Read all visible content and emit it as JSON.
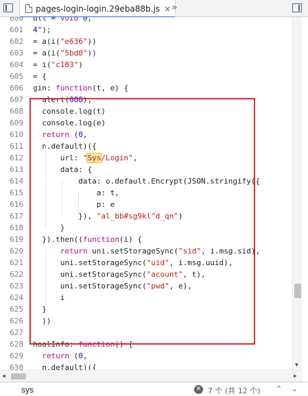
{
  "tabbar": {
    "file_name": "pages-login-login.29eba88b.js",
    "close_glyph": "×",
    "overflow_glyph": "»"
  },
  "search": {
    "query": "sys",
    "match_count": "7 个 (共 12 个)",
    "clear_glyph": "✕",
    "up_glyph": "⌃",
    "down_glyph": "⌄"
  },
  "scroll": {
    "up_glyph": "▲",
    "down_glyph": "▼",
    "left_glyph": "◀",
    "right_glyph": "▶"
  },
  "code": {
    "lines": [
      {
        "n": "600",
        "t": "ult = void 0,"
      },
      {
        "n": "601",
        "t": "4\");"
      },
      {
        "n": "602",
        "t": "= a(i(\"e636\"))"
      },
      {
        "n": "603",
        "t": "= a(i(\"5bd0\"))"
      },
      {
        "n": "604",
        "t": "= i(\"c183\")"
      },
      {
        "n": "605",
        "t": "= {"
      },
      {
        "n": "606",
        "t": "gin: function(t, e) {"
      },
      {
        "n": "607",
        "t": "  alert(888);"
      },
      {
        "n": "608",
        "t": "  console.log(t)"
      },
      {
        "n": "609",
        "t": "  console.log(e)"
      },
      {
        "n": "610",
        "t": "  return (0,"
      },
      {
        "n": "611",
        "t": "  n.default)({"
      },
      {
        "n": "612",
        "t": "      url: \"Sys/Login\","
      },
      {
        "n": "613",
        "t": "      data: {"
      },
      {
        "n": "614",
        "t": "          data: o.default.Encrypt(JSON.stringify({"
      },
      {
        "n": "615",
        "t": "              a: t,"
      },
      {
        "n": "616",
        "t": "              p: e"
      },
      {
        "n": "617",
        "t": "          }), \"al_bb#sg9kl^d_qn\")"
      },
      {
        "n": "618",
        "t": "      }"
      },
      {
        "n": "619",
        "t": "  }).then((function(i) {"
      },
      {
        "n": "620",
        "t": "      return uni.setStorageSync(\"sid\", i.msg.sid),"
      },
      {
        "n": "621",
        "t": "      uni.setStorageSync(\"uid\", i.msg.uuid),"
      },
      {
        "n": "622",
        "t": "      uni.setStorageSync(\"acount\", t),"
      },
      {
        "n": "623",
        "t": "      uni.setStorageSync(\"pwd\", e),"
      },
      {
        "n": "624",
        "t": "      i"
      },
      {
        "n": "625",
        "t": "  }"
      },
      {
        "n": "626",
        "t": "  ))"
      },
      {
        "n": "627",
        "t": ""
      },
      {
        "n": "628",
        "t": "hoolInfo: function() {"
      },
      {
        "n": "629",
        "t": "  return (0,"
      },
      {
        "n": "630",
        "t": "  n.default)({"
      }
    ]
  },
  "colors": {
    "keyword": "#aa0d91",
    "string": "#c41a16",
    "number": "#1c00cf",
    "highlight_box": "#e02c2c",
    "search_match": "#f8e9a1"
  }
}
